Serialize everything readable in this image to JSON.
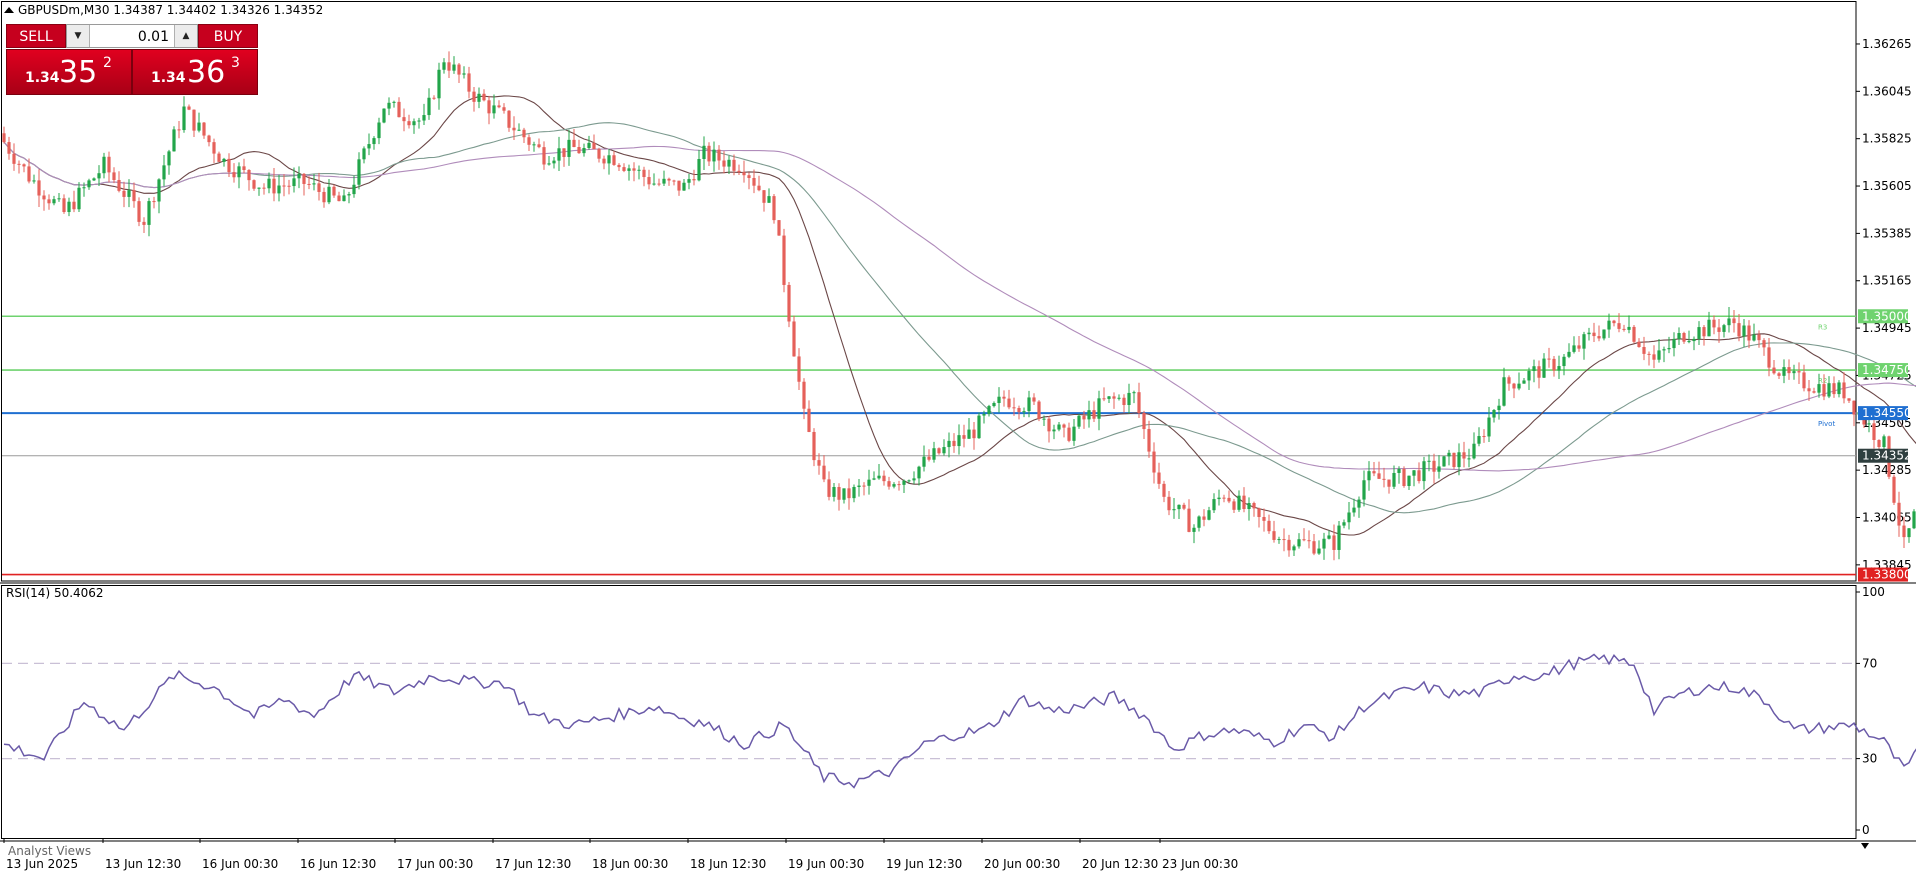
{
  "window": {
    "symbol_line": "GBPUSDm,M30  1.34387 1.34402 1.34326 1.34352"
  },
  "trade_panel": {
    "sell_label": "SELL",
    "buy_label": "BUY",
    "lot_value": "0.01",
    "sell_price": {
      "prefix": "1.34",
      "big": "35",
      "sup": "2"
    },
    "buy_price": {
      "prefix": "1.34",
      "big": "36",
      "sup": "3"
    }
  },
  "colors": {
    "bull": "#22a54a",
    "bear": "#e5605a",
    "green_level": "#6fd36f",
    "pivot": "#1f6fd1",
    "red_level": "#e02222",
    "ma_fast": "#6b4747",
    "ma_mid": "#7c9a8f",
    "ma_slow": "#b08cbb",
    "rsi_line": "#6a5aa8"
  },
  "chart_data": [
    {
      "type": "candlestick",
      "timeframe": "M30",
      "y_ticks": [
        "1.36265",
        "1.36045",
        "1.35825",
        "1.35605",
        "1.35385",
        "1.35165",
        "1.34945",
        "1.34725",
        "1.34505",
        "1.34285",
        "1.34065",
        "1.33845"
      ],
      "ylim": [
        1.3377,
        1.3646
      ],
      "x_ticks": [
        "13 Jun 2025",
        "13 Jun 12:30",
        "16 Jun 00:30",
        "16 Jun 12:30",
        "17 Jun 00:30",
        "17 Jun 12:30",
        "18 Jun 00:30",
        "18 Jun 12:30",
        "19 Jun 00:30",
        "19 Jun 12:30",
        "20 Jun 00:30",
        "20 Jun 12:30",
        "23 Jun 00:30"
      ],
      "levels": [
        {
          "value": 1.35,
          "label": "1.35000",
          "tag": "R3",
          "color": "#6fd36f"
        },
        {
          "value": 1.3475,
          "label": "1.34750",
          "tag": "R2",
          "color": "#6fd36f"
        },
        {
          "value": 1.3455,
          "label": "1.34550",
          "tag": "Pivot",
          "color": "#1f6fd1"
        },
        {
          "value": 1.338,
          "label": "1.33800",
          "tag": "",
          "color": "#e02222"
        }
      ],
      "current_price": "1.34352",
      "close_path": [
        [
          0,
          1.3581
        ],
        [
          5,
          1.3565
        ],
        [
          12,
          1.3548
        ],
        [
          20,
          1.357
        ],
        [
          28,
          1.3545
        ],
        [
          36,
          1.3596
        ],
        [
          44,
          1.3572
        ],
        [
          52,
          1.356
        ],
        [
          60,
          1.3562
        ],
        [
          68,
          1.3552
        ],
        [
          76,
          1.3598
        ],
        [
          84,
          1.359
        ],
        [
          88,
          1.362
        ],
        [
          94,
          1.3603
        ],
        [
          100,
          1.3592
        ],
        [
          108,
          1.3575
        ],
        [
          114,
          1.3578
        ],
        [
          122,
          1.3574
        ],
        [
          130,
          1.3562
        ],
        [
          136,
          1.356
        ],
        [
          140,
          1.3575
        ],
        [
          148,
          1.357
        ],
        [
          154,
          1.3549
        ],
        [
          160,
          1.3453
        ],
        [
          164,
          1.342
        ],
        [
          168,
          1.3416
        ],
        [
          174,
          1.3423
        ],
        [
          180,
          1.3425
        ],
        [
          186,
          1.3435
        ],
        [
          194,
          1.3447
        ],
        [
          200,
          1.3462
        ],
        [
          206,
          1.3458
        ],
        [
          212,
          1.3444
        ],
        [
          220,
          1.346
        ],
        [
          226,
          1.3463
        ],
        [
          232,
          1.3415
        ],
        [
          238,
          1.3402
        ],
        [
          244,
          1.3418
        ],
        [
          250,
          1.3407
        ],
        [
          256,
          1.3396
        ],
        [
          262,
          1.3394
        ],
        [
          266,
          1.3395
        ],
        [
          272,
          1.3424
        ],
        [
          280,
          1.3425
        ],
        [
          286,
          1.343
        ],
        [
          294,
          1.3437
        ],
        [
          300,
          1.3468
        ],
        [
          306,
          1.3474
        ],
        [
          312,
          1.348
        ],
        [
          318,
          1.3492
        ],
        [
          324,
          1.3498
        ],
        [
          330,
          1.3479
        ],
        [
          336,
          1.3492
        ],
        [
          342,
          1.3495
        ],
        [
          346,
          1.3497
        ],
        [
          350,
          1.3489
        ],
        [
          356,
          1.3472
        ],
        [
          362,
          1.3468
        ],
        [
          368,
          1.3465
        ],
        [
          372,
          1.3452
        ],
        [
          376,
          1.344
        ],
        [
          380,
          1.3393
        ],
        [
          384,
          1.342
        ],
        [
          388,
          1.3415
        ],
        [
          392,
          1.3432
        ],
        [
          398,
          1.3418
        ],
        [
          404,
          1.3434
        ],
        [
          410,
          1.3435
        ]
      ]
    },
    {
      "type": "line",
      "title": "RSI(14) 50.4062",
      "y_ticks": [
        "100",
        "70",
        "30",
        "0"
      ],
      "ylim": [
        0,
        100
      ],
      "levels": [
        70,
        30
      ],
      "points": [
        [
          0,
          36
        ],
        [
          8,
          30
        ],
        [
          16,
          54
        ],
        [
          24,
          42
        ],
        [
          34,
          65
        ],
        [
          42,
          60
        ],
        [
          50,
          48
        ],
        [
          56,
          55
        ],
        [
          62,
          48
        ],
        [
          70,
          65
        ],
        [
          78,
          58
        ],
        [
          86,
          65
        ],
        [
          94,
          62
        ],
        [
          100,
          62
        ],
        [
          106,
          48
        ],
        [
          114,
          44
        ],
        [
          122,
          48
        ],
        [
          130,
          52
        ],
        [
          136,
          47
        ],
        [
          140,
          45
        ],
        [
          148,
          36
        ],
        [
          156,
          44
        ],
        [
          164,
          22
        ],
        [
          170,
          20
        ],
        [
          178,
          25
        ],
        [
          184,
          36
        ],
        [
          190,
          40
        ],
        [
          196,
          42
        ],
        [
          204,
          55
        ],
        [
          210,
          50
        ],
        [
          216,
          52
        ],
        [
          222,
          56
        ],
        [
          228,
          48
        ],
        [
          234,
          34
        ],
        [
          240,
          40
        ],
        [
          246,
          42
        ],
        [
          254,
          37
        ],
        [
          260,
          44
        ],
        [
          266,
          39
        ],
        [
          272,
          52
        ],
        [
          278,
          57
        ],
        [
          284,
          60
        ],
        [
          290,
          57
        ],
        [
          296,
          58
        ],
        [
          302,
          65
        ],
        [
          308,
          65
        ],
        [
          314,
          70
        ],
        [
          320,
          72
        ],
        [
          326,
          70
        ],
        [
          330,
          50
        ],
        [
          334,
          56
        ],
        [
          340,
          60
        ],
        [
          346,
          60
        ],
        [
          352,
          55
        ],
        [
          358,
          42
        ],
        [
          364,
          43
        ],
        [
          370,
          44
        ],
        [
          376,
          37
        ],
        [
          380,
          25
        ],
        [
          384,
          36
        ],
        [
          390,
          38
        ],
        [
          394,
          35
        ],
        [
          398,
          44
        ],
        [
          404,
          46
        ],
        [
          408,
          50
        ],
        [
          410,
          52
        ]
      ]
    }
  ]
}
